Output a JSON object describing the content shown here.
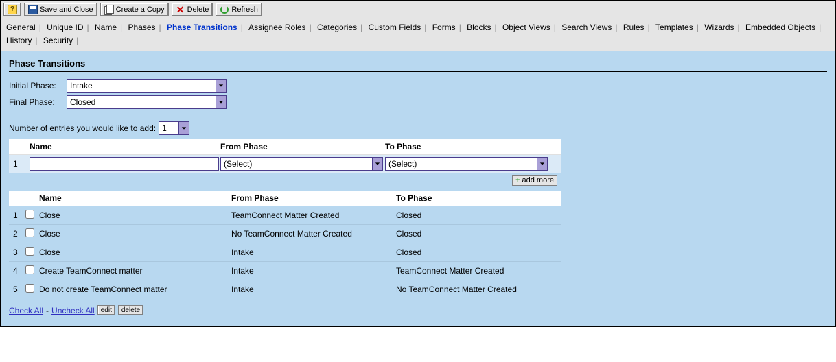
{
  "toolbar": {
    "save_close": "Save and Close",
    "create_copy": "Create a Copy",
    "delete": "Delete",
    "refresh": "Refresh"
  },
  "tabs": {
    "items": [
      "General",
      "Unique ID",
      "Name",
      "Phases",
      "Phase Transitions",
      "Assignee Roles",
      "Categories",
      "Custom Fields",
      "Forms",
      "Blocks",
      "Object Views",
      "Search Views",
      "Rules",
      "Templates",
      "Wizards",
      "Embedded Objects",
      "History",
      "Security"
    ],
    "active": "Phase Transitions"
  },
  "panel": {
    "title": "Phase Transitions",
    "initial_phase_label": "Initial Phase:",
    "final_phase_label": "Final Phase:",
    "initial_phase_value": "Intake",
    "final_phase_value": "Closed",
    "add_entries_label": "Number of entries you would like to add:",
    "add_entries_value": "1"
  },
  "entry_grid": {
    "headers": {
      "name": "Name",
      "from": "From Phase",
      "to": "To Phase"
    },
    "row": {
      "idx": "1",
      "name": "",
      "from": "(Select)",
      "to": "(Select)"
    },
    "add_more": "add more"
  },
  "list": {
    "headers": {
      "name": "Name",
      "from": "From Phase",
      "to": "To Phase"
    },
    "rows": [
      {
        "idx": "1",
        "name": "Close",
        "from": "TeamConnect Matter Created",
        "to": "Closed"
      },
      {
        "idx": "2",
        "name": "Close",
        "from": "No TeamConnect Matter Created",
        "to": "Closed"
      },
      {
        "idx": "3",
        "name": "Close",
        "from": "Intake",
        "to": "Closed"
      },
      {
        "idx": "4",
        "name": "Create TeamConnect matter",
        "from": "Intake",
        "to": "TeamConnect Matter Created"
      },
      {
        "idx": "5",
        "name": "Do not create TeamConnect matter",
        "from": "Intake",
        "to": "No TeamConnect Matter Created"
      }
    ]
  },
  "footer": {
    "check_all": "Check All",
    "uncheck_all": "Uncheck All",
    "edit": "edit",
    "delete": "delete",
    "sep": "-"
  }
}
